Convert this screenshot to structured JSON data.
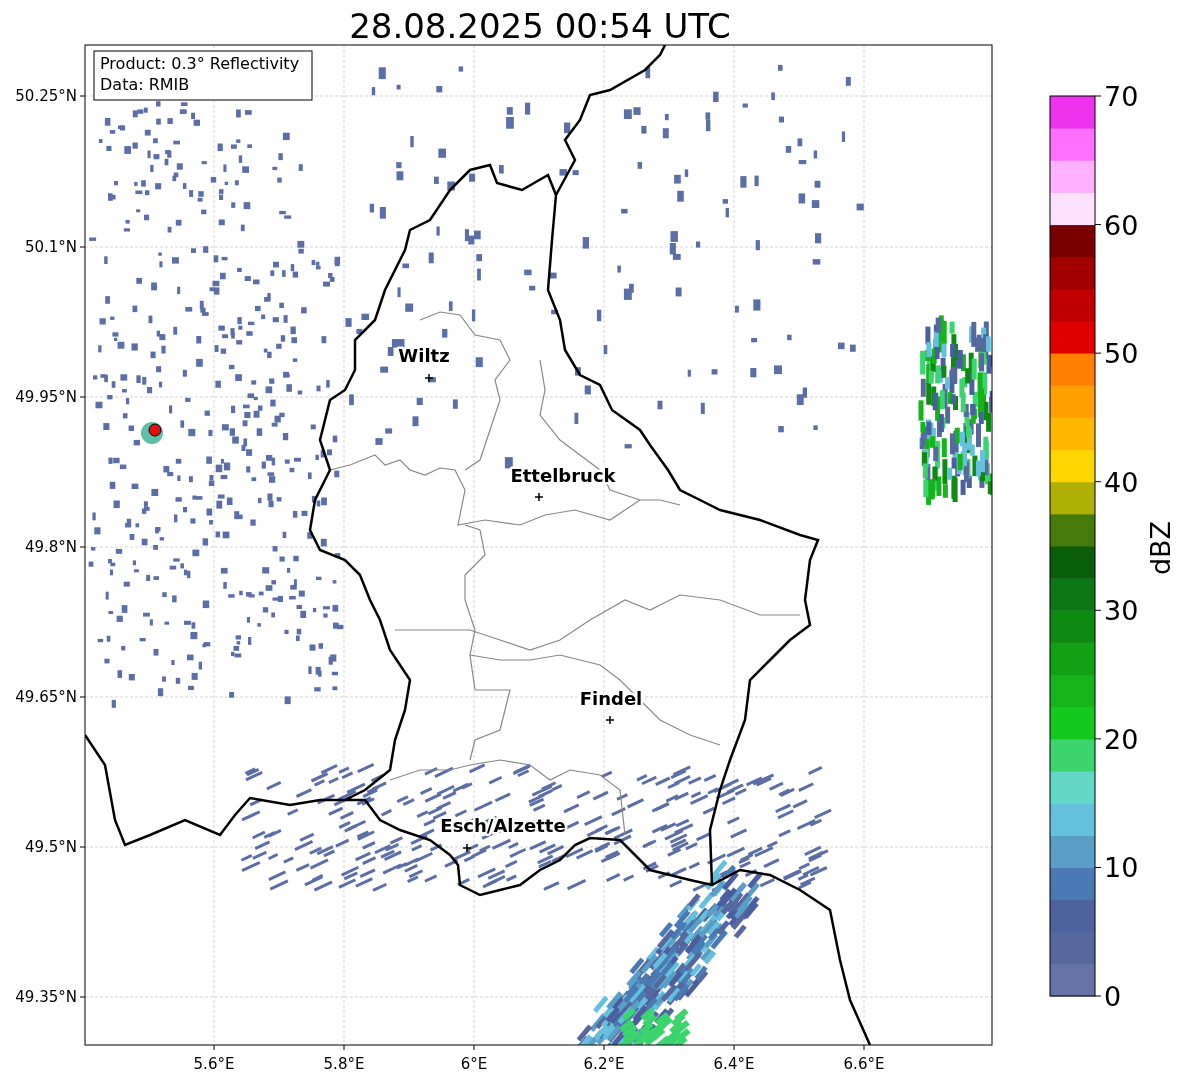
{
  "title": "28.08.2025 00:54 UTC",
  "info_box": {
    "lines": [
      "Product: 0.3° Reflectivity",
      "Data: RMIB"
    ]
  },
  "y_axis": {
    "ticks": [
      "50.25°N",
      "50.1°N",
      "49.95°N",
      "49.8°N",
      "49.65°N",
      "49.5°N",
      "49.35°N"
    ]
  },
  "x_axis": {
    "ticks": [
      "5.6°E",
      "5.8°E",
      "6°E",
      "6.2°E",
      "6.4°E",
      "6.6°E"
    ]
  },
  "cities": [
    {
      "name": "Wiltz"
    },
    {
      "name": "Ettelbruck"
    },
    {
      "name": "Findel"
    },
    {
      "name": "Esch/Alzette"
    }
  ],
  "colorbar": {
    "label": "dBZ",
    "ticks": [
      "70",
      "60",
      "50",
      "40",
      "30",
      "20",
      "10",
      "0"
    ],
    "segments": [
      {
        "color": "#6673a8"
      },
      {
        "color": "#56689e"
      },
      {
        "color": "#4e62a0"
      },
      {
        "color": "#4a7ab4"
      },
      {
        "color": "#5a9ec8"
      },
      {
        "color": "#64c0dc"
      },
      {
        "color": "#64d8c8"
      },
      {
        "color": "#3cd46c"
      },
      {
        "color": "#14c81e"
      },
      {
        "color": "#14b41a"
      },
      {
        "color": "#12a014"
      },
      {
        "color": "#0e8a12"
      },
      {
        "color": "#0c7612"
      },
      {
        "color": "#0a5e0a"
      },
      {
        "color": "#467a0a"
      },
      {
        "color": "#b0b004"
      },
      {
        "color": "#ffd600"
      },
      {
        "color": "#ffb800"
      },
      {
        "color": "#ff9f00"
      },
      {
        "color": "#ff7f00"
      },
      {
        "color": "#e00000"
      },
      {
        "color": "#c00000"
      },
      {
        "color": "#a00000"
      },
      {
        "color": "#7a0000"
      },
      {
        "color": "#ffe0ff"
      },
      {
        "color": "#ffb0ff"
      },
      {
        "color": "#ff70ff"
      },
      {
        "color": "#ee33ee"
      }
    ]
  }
}
